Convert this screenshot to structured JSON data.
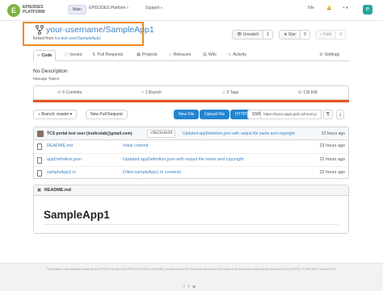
{
  "topbar": {
    "logo_mark": "E",
    "logo_text": "EPISODES PLATFORM",
    "logo_sub": "PLATFORM",
    "nav": [
      "Main",
      "EPISODES Platform",
      "Support"
    ],
    "right_items": [
      "Nfe",
      "Get"
    ]
  },
  "repo": {
    "owner": "your-username",
    "separator": "/",
    "name": "SampleApp1",
    "forked_prefix": "forked from",
    "forked_from": "tcs-test-user/SampleApp1"
  },
  "actions": {
    "unwatch_label": "Unwatch",
    "unwatch_count": "1",
    "star_label": "Star",
    "star_count": "0",
    "fork_label": "Fork",
    "fork_count": "0"
  },
  "tabs": [
    {
      "icon": "code-icon",
      "label": "Code"
    },
    {
      "icon": "issues-icon",
      "label": "Issues"
    },
    {
      "icon": "pull-request-icon",
      "label": "Pull Requests"
    },
    {
      "icon": "projects-icon",
      "label": "Projects"
    },
    {
      "icon": "releases-icon",
      "label": "Releases"
    },
    {
      "icon": "wiki-icon",
      "label": "Wiki"
    },
    {
      "icon": "activity-icon",
      "label": "Activity"
    },
    {
      "icon": "settings-icon",
      "label": "Settings"
    }
  ],
  "description": "No Description",
  "manage_topics": "Manage Topics",
  "stats": {
    "commits": "5 Commits",
    "branch": "1 Branch",
    "tags": "0 Tags",
    "size": "135 KiB",
    "bar_color": "#e95420"
  },
  "branch_row": {
    "branch_label": "Branch: master",
    "new_pull_request": "New Pull Request",
    "new_file": "New File",
    "upload_file": "Upload File",
    "https": "HTTPS",
    "ssh": "SSH",
    "clone_url": "https://epos-apps.grid.cyfronet.p"
  },
  "latest_commit": {
    "user": "TCS portal test user (irsdicolab@gmail.com)",
    "sha": "c5b23c4e19",
    "message": "Updated appDefinition.json with output file name and copyright",
    "time": "22 hours ago"
  },
  "files": [
    {
      "name": "README.md",
      "message": "Initial commit",
      "time": "23 hours ago"
    },
    {
      "name": "appDefinition.json",
      "message": "Updated appDefinition.json with output file name and copyright",
      "time": "22 hours ago"
    },
    {
      "name": "sampleApp1.m",
      "message": "Filled sampleApp1.m contents",
      "time": "22 hours ago"
    }
  ],
  "readme": {
    "header": "README.md",
    "heading": "SampleApp1"
  },
  "footer": {
    "text": "This platform was partially funded by the EPOS-PL project (No POIR.04.02.00-14-A003/16), co-financed by the European Union from the funds of the European Regional Development Fund (ERDF). © 2021 ACC Cyfronet AGH"
  }
}
